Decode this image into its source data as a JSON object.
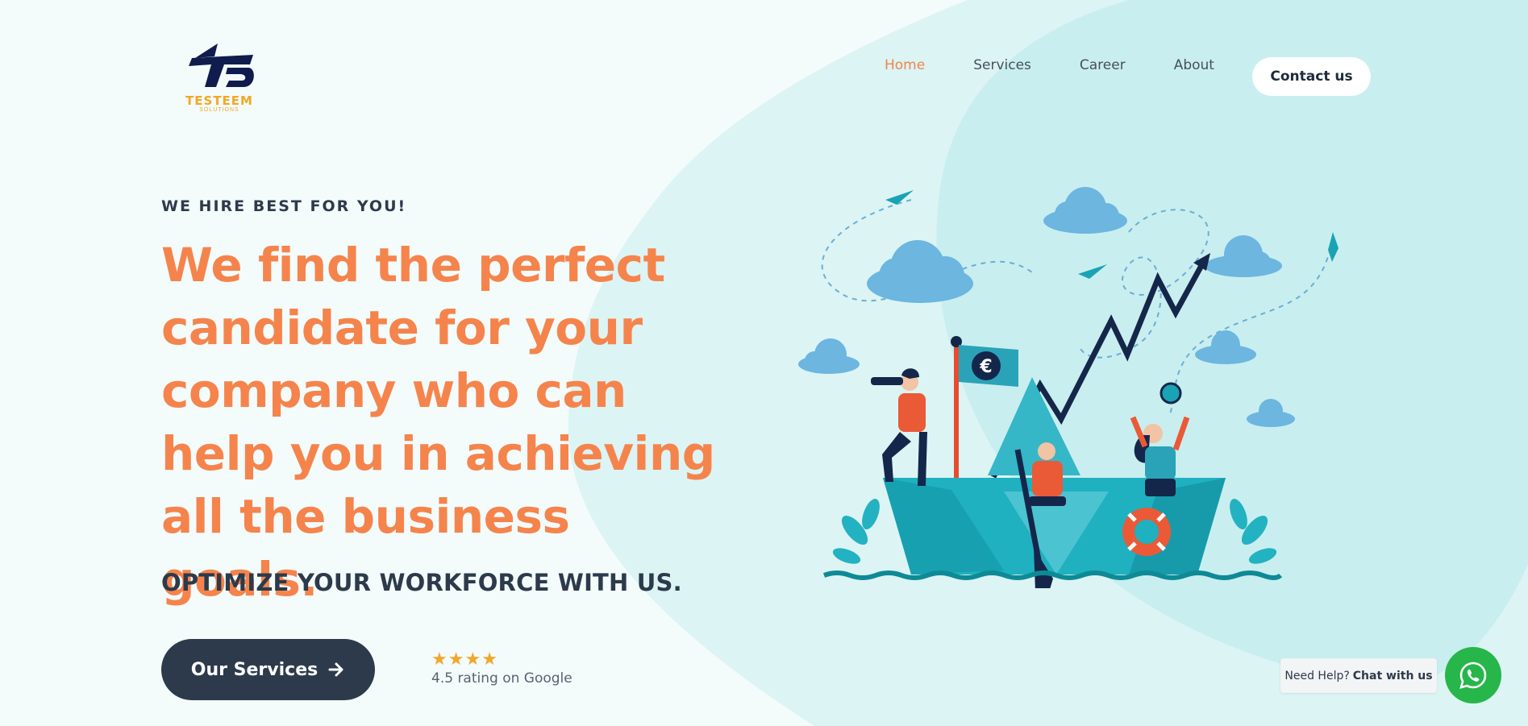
{
  "brand": {
    "logo_text": "TESTEEM",
    "logo_sub": "SOLUTIONS",
    "colors": {
      "navy": "#0f1c4d",
      "orange": "#f5844c",
      "gold": "#f5a623",
      "teal": "#c8eef0",
      "dark_button": "#2d3a4b",
      "whatsapp": "#26b64a"
    }
  },
  "nav": {
    "items": [
      {
        "label": "Home",
        "active": true
      },
      {
        "label": "Services",
        "active": false
      },
      {
        "label": "Career",
        "active": false
      },
      {
        "label": "About",
        "active": false
      }
    ],
    "contact_label": "Contact us"
  },
  "hero": {
    "eyebrow": "WE HIRE BEST FOR YOU!",
    "headline": "We find the perfect candidate for your company who can help you in achieving all the business goals.",
    "tagline": "OPTIMIZE YOUR WORKFORCE WITH US.",
    "cta_label": "Our Services",
    "cta_icon": "arrow-right-icon"
  },
  "rating": {
    "stars": 4,
    "text": "4.5 rating on Google"
  },
  "chat": {
    "need_help": "Need Help?",
    "chat_label": "Chat with us",
    "icon": "whatsapp-icon"
  },
  "illustration": {
    "flag_symbol": "€",
    "icon": "paper-boat-team-illustration"
  }
}
